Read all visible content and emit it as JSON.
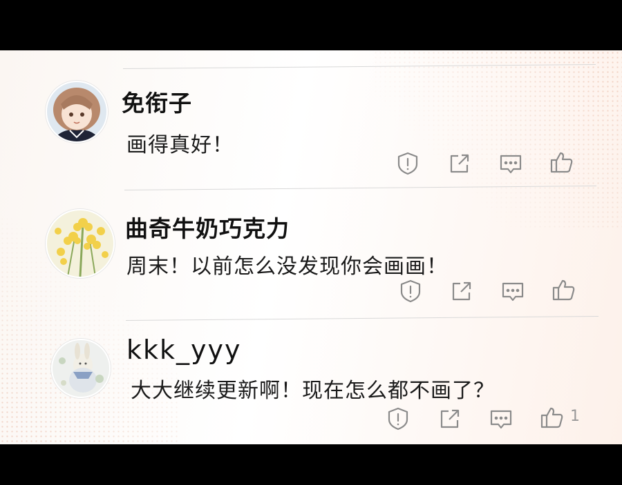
{
  "comments": [
    {
      "username": "免衔子",
      "text": "画得真好！",
      "avatar_icon": "anime-girl-avatar",
      "actions": {
        "report": "report-icon",
        "share": "share-icon",
        "reply": "reply-icon",
        "like": "like-icon"
      },
      "like_count": ""
    },
    {
      "username": "曲奇牛奶巧克力",
      "text": "周末！以前怎么没发现你会画画！",
      "avatar_icon": "yellow-flower-avatar",
      "actions": {
        "report": "report-icon",
        "share": "share-icon",
        "reply": "reply-icon",
        "like": "like-icon"
      },
      "like_count": ""
    },
    {
      "username": "kkk_yyy",
      "text": "大大继续更新啊！现在怎么都不画了？",
      "avatar_icon": "rabbit-illustration-avatar",
      "actions": {
        "report": "report-icon",
        "share": "share-icon",
        "reply": "reply-icon",
        "like": "like-icon"
      },
      "like_count": "1"
    }
  ],
  "colors": {
    "text": "#1a1a1a",
    "icon": "#8a8a8a",
    "divider": "#d8d8d8",
    "letterbox": "#000000",
    "accent_dots": "#e8b6a0"
  }
}
